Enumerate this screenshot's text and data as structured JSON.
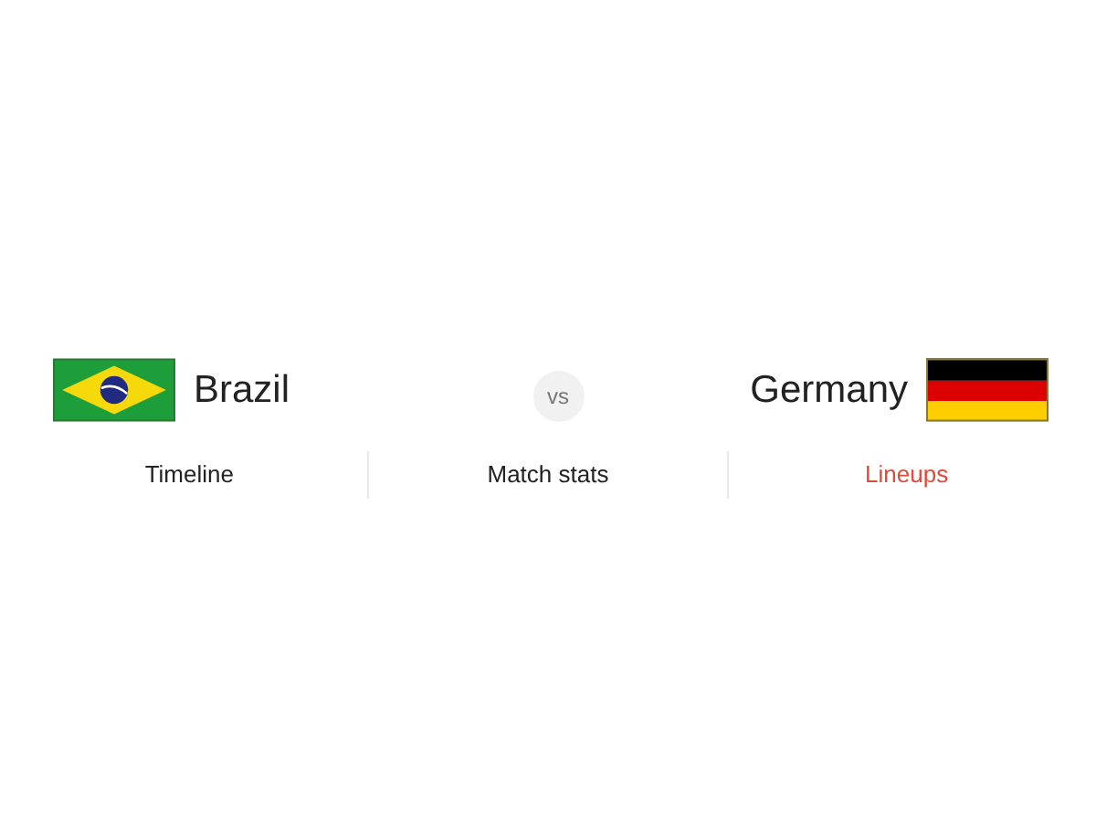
{
  "match": {
    "home": {
      "name": "Brazil"
    },
    "versus": "vs",
    "away": {
      "name": "Germany"
    }
  },
  "tabs": [
    {
      "label": "Timeline",
      "selected": false
    },
    {
      "label": "Match stats",
      "selected": false
    },
    {
      "label": "Lineups",
      "selected": true
    }
  ]
}
